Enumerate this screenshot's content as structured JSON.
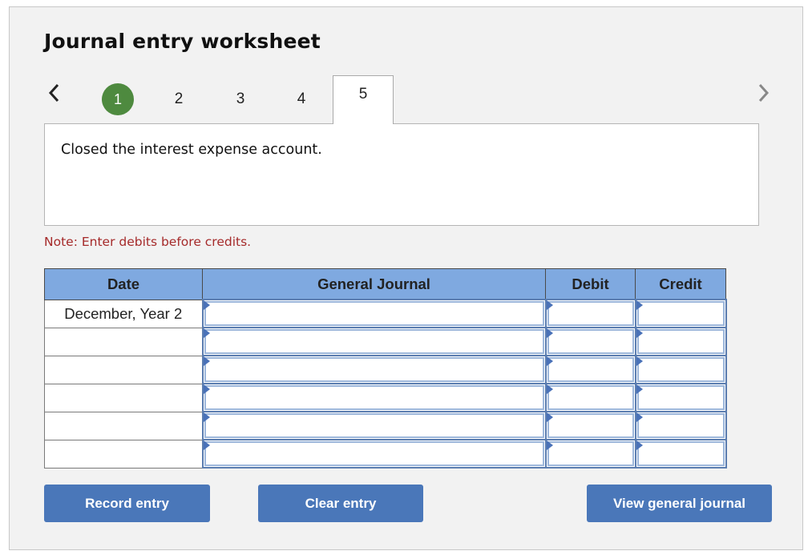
{
  "title": "Journal entry worksheet",
  "navigation": {
    "prev_icon": "chevron-left-icon",
    "next_icon": "chevron-right-icon",
    "steps": [
      {
        "label": "1",
        "state": "completed"
      },
      {
        "label": "2",
        "state": "default"
      },
      {
        "label": "3",
        "state": "default"
      },
      {
        "label": "4",
        "state": "default"
      },
      {
        "label": "5",
        "state": "active"
      }
    ],
    "completed_color": "#4e8a3f"
  },
  "description": "Closed the interest expense account.",
  "note": "Note: Enter debits before credits.",
  "table": {
    "headers": [
      "Date",
      "General Journal",
      "Debit",
      "Credit"
    ],
    "header_color": "#7fa9e0",
    "rows": [
      {
        "date": "December, Year 2",
        "account": "",
        "debit": "",
        "credit": ""
      },
      {
        "date": "",
        "account": "",
        "debit": "",
        "credit": ""
      },
      {
        "date": "",
        "account": "",
        "debit": "",
        "credit": ""
      },
      {
        "date": "",
        "account": "",
        "debit": "",
        "credit": ""
      },
      {
        "date": "",
        "account": "",
        "debit": "",
        "credit": ""
      },
      {
        "date": "",
        "account": "",
        "debit": "",
        "credit": ""
      }
    ]
  },
  "buttons": {
    "record": "Record entry",
    "clear": "Clear entry",
    "view": "View general journal",
    "color": "#4a77b9"
  }
}
